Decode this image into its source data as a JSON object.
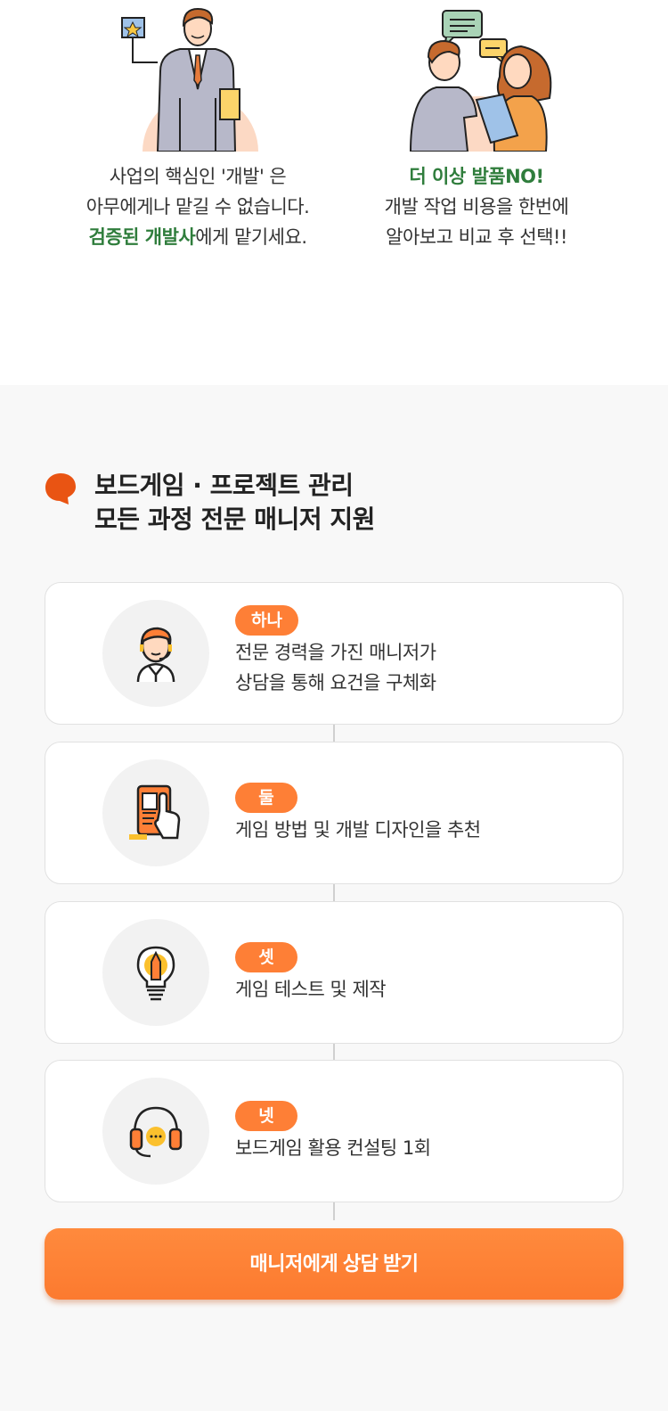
{
  "intro": {
    "left": {
      "line1": "사업의 핵심인 '개발' 은",
      "line2": "아무에게나 맡길 수 없습니다.",
      "line3_highlight": "검증된 개발사",
      "line3_rest": "에게 맡기세요."
    },
    "right": {
      "line1_highlight": "더 이상 발품NO!",
      "line2": "개발 작업 비용을 한번에",
      "line3": "알아보고 비교 후 선택!!"
    }
  },
  "section": {
    "title_line1": "보드게임 · 프로젝트 관리",
    "title_line2": "모든 과정 전문 매니저 지원"
  },
  "steps": [
    {
      "badge": "하나",
      "line1": "전문 경력을 가진 매니저가",
      "line2": "상담을 통해 요건을 구체화",
      "icon": "manager-headset-icon"
    },
    {
      "badge": "둘",
      "line1": "게임 방법 및 개발 디자인을 추천",
      "icon": "tablet-touch-icon"
    },
    {
      "badge": "셋",
      "line1": "게임 테스트 및 제작",
      "icon": "lightbulb-pencil-icon"
    },
    {
      "badge": "넷",
      "line1": "보드게임 활용 컨설팅 1회",
      "icon": "headphones-chat-icon"
    }
  ],
  "cta": {
    "label": "매니저에게 상담 받기"
  },
  "colors": {
    "accent": "#fe7f36",
    "green": "#2f7d3c",
    "bg_gray": "#f8f8f8"
  }
}
